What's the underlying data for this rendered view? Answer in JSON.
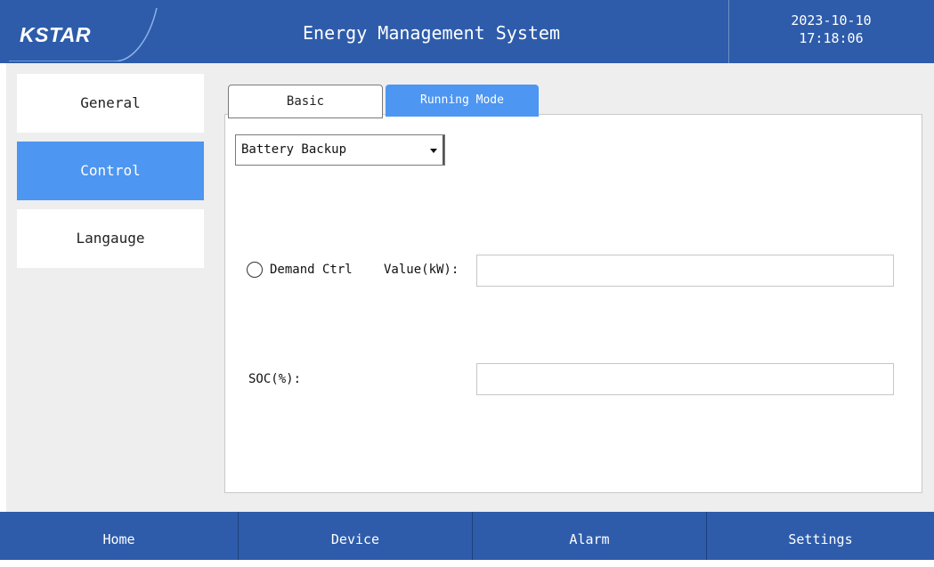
{
  "header": {
    "logo": "KSTAR",
    "title": "Energy Management System",
    "date": "2023-10-10",
    "time": "17:18:06"
  },
  "sidebar": {
    "items": [
      {
        "label": "General",
        "active": false
      },
      {
        "label": "Control",
        "active": true
      },
      {
        "label": "Langauge",
        "active": false
      }
    ]
  },
  "tabs": [
    {
      "label": "Basic",
      "active": false
    },
    {
      "label": "Running Mode",
      "active": true
    }
  ],
  "running_mode": {
    "selected": "Battery Backup",
    "demand_ctrl_label": "Demand Ctrl",
    "demand_ctrl_checked": false,
    "value_label": "Value(kW):",
    "value": "",
    "soc_label": "SOC(%):",
    "soc_value": ""
  },
  "footer": {
    "nav": [
      "Home",
      "Device",
      "Alarm",
      "Settings"
    ]
  },
  "colors": {
    "header_bg": "#2e5cab",
    "accent": "#4d96f1",
    "workspace_bg": "#eeeeee"
  }
}
